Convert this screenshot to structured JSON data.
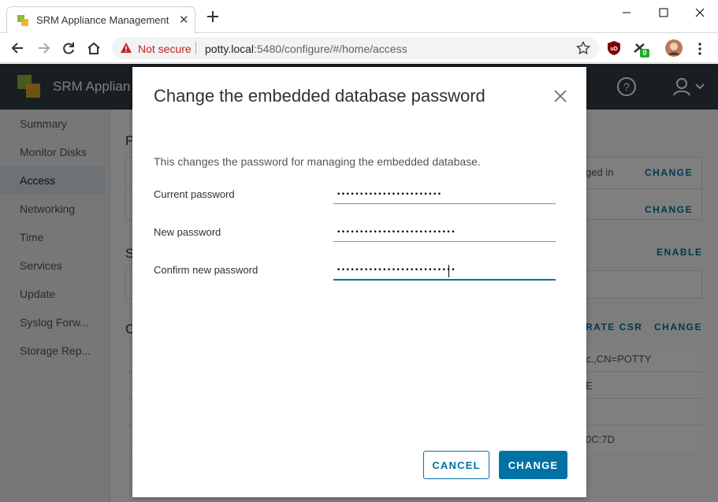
{
  "browser": {
    "tab_title": "SRM Appliance Management",
    "security_label": "Not secure",
    "url_host": "potty.local",
    "url_path": ":5480/configure/#/home/access",
    "extension_badge": "0"
  },
  "app": {
    "title": "SRM Applian",
    "sidebar": [
      {
        "label": "Summary"
      },
      {
        "label": "Monitor Disks"
      },
      {
        "label": "Access"
      },
      {
        "label": "Networking"
      },
      {
        "label": "Time"
      },
      {
        "label": "Services"
      },
      {
        "label": "Update"
      },
      {
        "label": "Syslog Forw..."
      },
      {
        "label": "Storage Rep..."
      }
    ],
    "section_letters": [
      "P",
      "S",
      "C"
    ],
    "background_text": {
      "logged_in": "ged in",
      "change_1": "CHANGE",
      "change_2": "CHANGE",
      "enable": "ENABLE",
      "generate_csr": "RATE CSR",
      "change_3": "CHANGE",
      "cert_subject": "c.,CN=POTTY",
      "cert_e": "E",
      "cert_hash": "0C:7D"
    }
  },
  "modal": {
    "title": "Change the embedded database password",
    "description": "This changes the password for managing the embedded database.",
    "fields": [
      {
        "label": "Current password",
        "value": "•••••••••••••••••••••••"
      },
      {
        "label": "New password",
        "value": "••••••••••••••••••••••••••"
      },
      {
        "label": "Confirm new password",
        "value": "••••••••••••••••••••••••••"
      }
    ],
    "cancel_label": "CANCEL",
    "change_label": "CHANGE"
  },
  "colors": {
    "accent": "#0072a3",
    "header_bg": "#313c45",
    "warning": "#c5221f"
  }
}
